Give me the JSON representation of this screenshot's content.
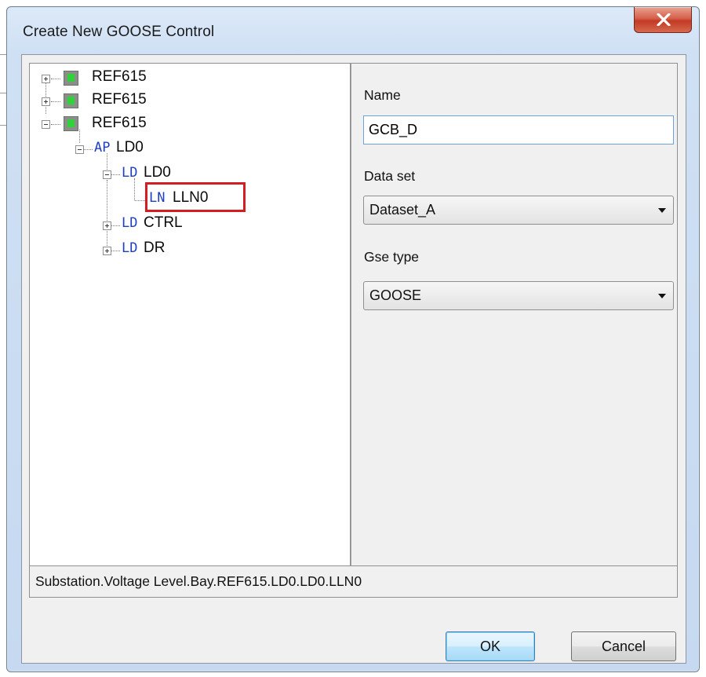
{
  "window": {
    "title": "Create New GOOSE Control",
    "close_label": "X"
  },
  "tree": {
    "nodes": [
      {
        "type": "IED",
        "label": "REF615",
        "expander": "plus"
      },
      {
        "type": "IED",
        "label": "REF615",
        "expander": "plus"
      },
      {
        "type": "IED",
        "label": "REF615",
        "expander": "minus"
      },
      {
        "type": "AP",
        "label": "LD0",
        "expander": "minus"
      },
      {
        "type": "LD",
        "label": "LD0",
        "expander": "minus"
      },
      {
        "type": "LN",
        "label": "LLN0",
        "selected": true
      },
      {
        "type": "LD",
        "label": "CTRL",
        "expander": "plus"
      },
      {
        "type": "LD",
        "label": "DR",
        "expander": "plus"
      }
    ]
  },
  "properties": {
    "name_label": "Name",
    "name_value": "GCB_D",
    "dataset_label": "Data set",
    "dataset_value": "Dataset_A",
    "gse_type_label": "Gse type",
    "gse_type_value": "GOOSE"
  },
  "status": {
    "path": "Substation.Voltage Level.Bay.REF615.LD0.LD0.LLN0"
  },
  "buttons": {
    "ok": "OK",
    "cancel": "Cancel"
  },
  "colors": {
    "highlight": "#d21d23",
    "tag_text": "#1f3fc0",
    "close_button": "#c94a34"
  }
}
